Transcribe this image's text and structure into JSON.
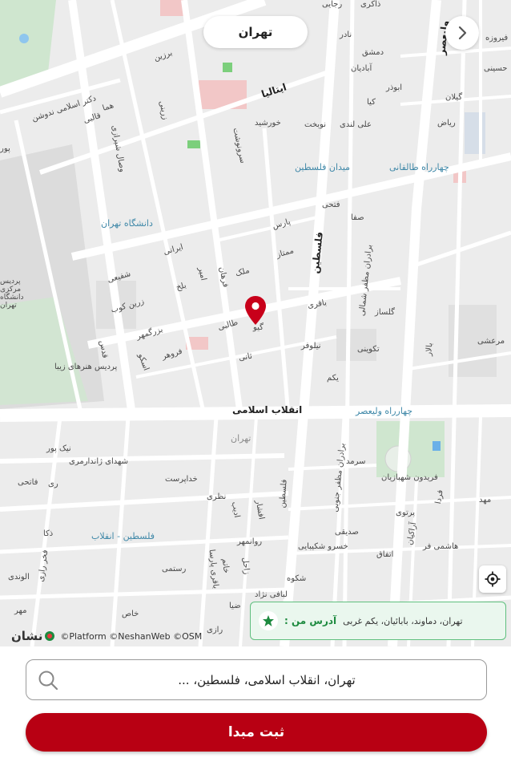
{
  "header": {
    "city": "تهران"
  },
  "map": {
    "labels": {
      "enghelab": "انقلاب اسلامی",
      "felestin_n": "فلسطین",
      "felestin_s": "فلسطین",
      "valiasr": "ولیعصر",
      "italia": "ایتالیا",
      "bozorgmehr": "بزرگمهر",
      "vesal": "وصال شیرازی",
      "qods": "قدس",
      "fatemi": "فتحی",
      "safa": "صفا",
      "pars": "پارس",
      "mamtaz": "ممتاز",
      "malek": "ملک",
      "farhan": "فرهان",
      "iranai": "ایرانی",
      "shafii": "شفیعی",
      "zarinkoob": "زرین کوب",
      "balkh": "بلخ",
      "amir": "امیر",
      "taleghani": "طالبی",
      "giv": "گیو",
      "baqeri": "باقری",
      "golsaz": "گلساز",
      "niloufar": "نیلوفر",
      "takavi": "تکوینی",
      "bekam": "یکم",
      "naderi": "نادر",
      "nobakht": "نوبخت",
      "khorshid": "خورشید",
      "alilondi": "علی لندی",
      "abuzar": "ابوذر",
      "gilan": "گیلان",
      "riaz": "ریاض",
      "firoozeh": "فیروزه",
      "hosseini": "حسینی",
      "zakeri": "ذاکری",
      "rajabi": "رجایی",
      "damashq": "دمشق",
      "abadian": "آبادیان",
      "kia": "کیا",
      "barzin": "برزین",
      "doctor": "دکتر اسلامی ندوشن",
      "zarini": "زرینی",
      "shahid_zandarmi": "شهدای ژاندارمری",
      "nikpour": "نیک پور",
      "khodaparast": "خداپرست",
      "nazari": "نظری",
      "adib": "ادیب",
      "afshar": "افشار",
      "ravanmehr": "روانمهر",
      "rostami": "رستمی",
      "baqerparsa": "باقری پارسا",
      "khatam": "خاتم",
      "zahel": "زاحل",
      "shokuh": "شکوه",
      "lavaf": "لبافی نژاد",
      "zia": "ضیا",
      "razi": "رازی",
      "khas": "خاص",
      "mehr": "مهر",
      "sarmad": "سرمد",
      "fereydoon": "فریدون شهبازیان",
      "parto": "پرتوی",
      "farda": "فردا",
      "mahdi": "مهد",
      "sadiqi": "صدیقی",
      "khosroshakibaei": "خسرو شکیبایی",
      "etefaq": "اتفاق",
      "arakian": "آراکیان",
      "hashemifar": "هاشمی فر",
      "barad_north": "برادران مظفر شمالی",
      "barad_south": "برادران مظفر جنوبی",
      "mareshi": "مرعشی",
      "bolor": "بالار",
      "fakhr": "فخر رازی",
      "alvandi": "الوندی",
      "zaka": "ذکا",
      "tani": "ثانی",
      "esko": "اسکو",
      "forouhar": "فروهر",
      "sarvnaz": "سرونوشت",
      "fateh": "فاتحی",
      "ri": "ری",
      "sq_felestin": "میدان فلسطین",
      "chaharrah_taleghani": "چهارراه طالقانی",
      "chaharrah_valiasr": "چهارراه ولیعصر",
      "university": "دانشگاه تهران",
      "felestin_enghelab": "فلسطین - انقلاب",
      "tehran_small": "تهران",
      "honar_campus": "پردیس هنرهای زیبا",
      "campus2": "پردیس مرکزی دانشگاه تهران",
      "ghalebi": "قالبی",
      "hema": "هما",
      "poor": "پور"
    }
  },
  "address_card": {
    "title": "آدرس من :",
    "text": "تهران، دماوند، بابائیان، یکم غربی"
  },
  "attribution": {
    "brand": "نشان",
    "text": "©Platform ©NeshanWeb ©OSM"
  },
  "search": {
    "value": "تهران، انقلاب اسلامی، فلسطین، ..."
  },
  "submit": {
    "label": "ثبت مبدا"
  },
  "colors": {
    "accent": "#b80013",
    "green": "#1d8a3f",
    "road": "#ffffff",
    "land": "#ececec"
  }
}
